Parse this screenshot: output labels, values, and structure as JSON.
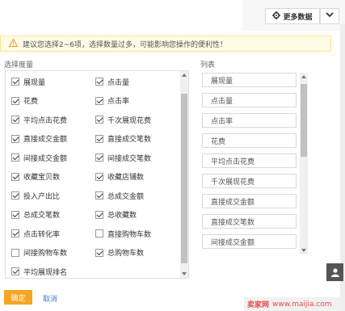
{
  "header": {
    "more_button_label": "更多数据"
  },
  "warning": {
    "text": "建议您选择2~6项，选择数量过多，可能影响您操作的便利性！"
  },
  "select_label": "选择度量",
  "list_label": "列表",
  "options": [
    {
      "label": "展现量",
      "checked": true
    },
    {
      "label": "点击量",
      "checked": true
    },
    {
      "label": "花费",
      "checked": true
    },
    {
      "label": "点击率",
      "checked": true
    },
    {
      "label": "平均点击花费",
      "checked": true
    },
    {
      "label": "千次展现花费",
      "checked": true
    },
    {
      "label": "直接成交金额",
      "checked": true
    },
    {
      "label": "直接成交笔数",
      "checked": true
    },
    {
      "label": "间接成交金额",
      "checked": true
    },
    {
      "label": "间接成交笔数",
      "checked": true
    },
    {
      "label": "收藏宝贝数",
      "checked": true
    },
    {
      "label": "收藏店铺数",
      "checked": true
    },
    {
      "label": "投入产出比",
      "checked": true
    },
    {
      "label": "总成交金额",
      "checked": true
    },
    {
      "label": "总成交笔数",
      "checked": true
    },
    {
      "label": "总收藏数",
      "checked": true
    },
    {
      "label": "点击转化率",
      "checked": true
    },
    {
      "label": "直接购物车数",
      "checked": false
    },
    {
      "label": "间接购物车数",
      "checked": false
    },
    {
      "label": "总购物车数",
      "checked": true
    },
    {
      "label": "平均展现排名",
      "checked": true
    }
  ],
  "list_items": [
    "展现量",
    "点击量",
    "点击率",
    "花费",
    "平均点击花费",
    "千次展现花费",
    "直接成交金额",
    "直接成交笔数",
    "间接成交金额"
  ],
  "footer": {
    "confirm_label": "确定",
    "cancel_label": "取消"
  },
  "watermark": {
    "brand": "卖家网",
    "url": "www.maijia.com"
  },
  "colors": {
    "accent": "#f5a623",
    "link": "#3a7bd5",
    "warning_bg": "#fffbe6"
  }
}
